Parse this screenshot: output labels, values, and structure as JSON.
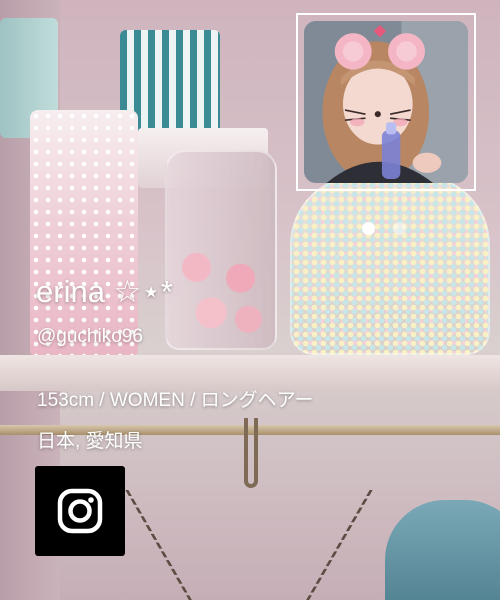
{
  "profile": {
    "display_name": "erina ☆⋆*",
    "username": "@guchiko96",
    "attributes": "153cm / WOMEN / ロングヘアー",
    "location": "日本, 愛知県"
  },
  "gallery": {
    "thumbnail_icon": "photo-thumbnail",
    "slide_count": 2,
    "active_slide": 1
  },
  "social": {
    "instagram_icon": "instagram-icon"
  },
  "colors": {
    "text": "#ffffff",
    "social_button_bg": "#000000",
    "dot_active": "#ffffff",
    "dot_inactive": "rgba(255,255,255,0.45)"
  }
}
